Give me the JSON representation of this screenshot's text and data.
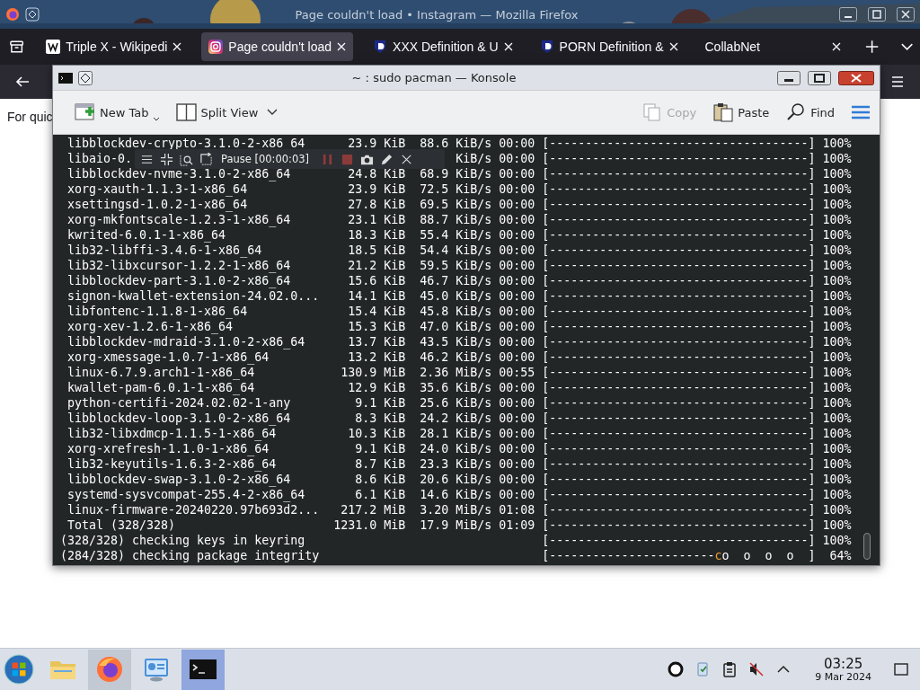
{
  "firefox": {
    "title": "Page couldn't load • Instagram — Mozilla Firefox",
    "tabs": [
      {
        "label": "Triple X - Wikipedi",
        "kind": "page",
        "selected": false
      },
      {
        "label": "Page couldn't load",
        "kind": "camera",
        "selected": true
      },
      {
        "label": "XXX Definition & U",
        "kind": "shield",
        "selected": false
      },
      {
        "label": "PORN Definition &",
        "kind": "shield",
        "selected": false
      },
      {
        "label": "CollabNet",
        "kind": "plain",
        "selected": false
      }
    ],
    "page_text": "For quic"
  },
  "konsole": {
    "title": "~ : sudo pacman — Konsole",
    "toolbar_left": [
      {
        "label": "New Tab",
        "kind": "new-tab",
        "disabled": false
      },
      {
        "label": "Split View",
        "kind": "split",
        "disabled": false
      }
    ],
    "toolbar_right": [
      {
        "label": "Copy",
        "kind": "copy",
        "disabled": true
      },
      {
        "label": "Paste",
        "kind": "paste",
        "disabled": false
      },
      {
        "label": "Find",
        "kind": "find",
        "disabled": false
      }
    ],
    "rows": [
      {
        "kind": "package",
        "name": "libblockdev-crypto-3.1.0-2-x86_64",
        "size": "23.9 KiB",
        "speed": "88.6 KiB/s",
        "time": "00:00",
        "bar": "[------------------------------------]",
        "percent": "100%"
      },
      {
        "kind": "package",
        "name": "libaio-0.",
        "speed": "KiB/s",
        "time": "00:00",
        "bar": "[------------------------------------]",
        "percent": "100%"
      },
      {
        "kind": "package",
        "name": "libblockdev-nvme-3.1.0-2-x86_64",
        "size": "24.8 KiB",
        "speed": "68.9 KiB/s",
        "time": "00:00",
        "bar": "[------------------------------------]",
        "percent": "100%"
      },
      {
        "kind": "package",
        "name": "xorg-xauth-1.1.3-1-x86_64",
        "size": "23.9 KiB",
        "speed": "72.5 KiB/s",
        "time": "00:00",
        "bar": "[------------------------------------]",
        "percent": "100%"
      },
      {
        "kind": "package",
        "name": "xsettingsd-1.0.2-1-x86_64",
        "size": "27.8 KiB",
        "speed": "69.5 KiB/s",
        "time": "00:00",
        "bar": "[------------------------------------]",
        "percent": "100%"
      },
      {
        "kind": "package",
        "name": "xorg-mkfontscale-1.2.3-1-x86_64",
        "size": "23.1 KiB",
        "speed": "88.7 KiB/s",
        "time": "00:00",
        "bar": "[------------------------------------]",
        "percent": "100%"
      },
      {
        "kind": "package",
        "name": "kwrited-6.0.1-1-x86_64",
        "size": "18.3 KiB",
        "speed": "55.4 KiB/s",
        "time": "00:00",
        "bar": "[------------------------------------]",
        "percent": "100%"
      },
      {
        "kind": "package",
        "name": "lib32-libffi-3.4.6-1-x86_64",
        "size": "18.5 KiB",
        "speed": "54.4 KiB/s",
        "time": "00:00",
        "bar": "[------------------------------------]",
        "percent": "100%"
      },
      {
        "kind": "package",
        "name": "lib32-libxcursor-1.2.2-1-x86_64",
        "size": "21.2 KiB",
        "speed": "59.5 KiB/s",
        "time": "00:00",
        "bar": "[------------------------------------]",
        "percent": "100%"
      },
      {
        "kind": "package",
        "name": "libblockdev-part-3.1.0-2-x86_64",
        "size": "15.6 KiB",
        "speed": "46.7 KiB/s",
        "time": "00:00",
        "bar": "[------------------------------------]",
        "percent": "100%"
      },
      {
        "kind": "package",
        "name": "signon-kwallet-extension-24.02.0...",
        "size": "14.1 KiB",
        "speed": "45.0 KiB/s",
        "time": "00:00",
        "bar": "[------------------------------------]",
        "percent": "100%"
      },
      {
        "kind": "package",
        "name": "libfontenc-1.1.8-1-x86_64",
        "size": "15.4 KiB",
        "speed": "45.8 KiB/s",
        "time": "00:00",
        "bar": "[------------------------------------]",
        "percent": "100%"
      },
      {
        "kind": "package",
        "name": "xorg-xev-1.2.6-1-x86_64",
        "size": "15.3 KiB",
        "speed": "47.0 KiB/s",
        "time": "00:00",
        "bar": "[------------------------------------]",
        "percent": "100%"
      },
      {
        "kind": "package",
        "name": "libblockdev-mdraid-3.1.0-2-x86_64",
        "size": "13.7 KiB",
        "speed": "43.5 KiB/s",
        "time": "00:00",
        "bar": "[------------------------------------]",
        "percent": "100%"
      },
      {
        "kind": "package",
        "name": "xorg-xmessage-1.0.7-1-x86_64",
        "size": "13.2 KiB",
        "speed": "46.2 KiB/s",
        "time": "00:00",
        "bar": "[------------------------------------]",
        "percent": "100%"
      },
      {
        "kind": "package",
        "name": "linux-6.7.9.arch1-1-x86_64",
        "size": "130.9 MiB",
        "speed": "2.36 MiB/s",
        "time": "00:55",
        "bar": "[------------------------------------]",
        "percent": "100%"
      },
      {
        "kind": "package",
        "name": "kwallet-pam-6.0.1-1-x86_64",
        "size": "12.9 KiB",
        "speed": "35.6 KiB/s",
        "time": "00:00",
        "bar": "[------------------------------------]",
        "percent": "100%"
      },
      {
        "kind": "package",
        "name": "python-certifi-2024.02.02-1-any",
        "size": "9.1 KiB",
        "speed": "25.6 KiB/s",
        "time": "00:00",
        "bar": "[------------------------------------]",
        "percent": "100%"
      },
      {
        "kind": "package",
        "name": "libblockdev-loop-3.1.0-2-x86_64",
        "size": "8.3 KiB",
        "speed": "24.2 KiB/s",
        "time": "00:00",
        "bar": "[------------------------------------]",
        "percent": "100%"
      },
      {
        "kind": "package",
        "name": "lib32-libxdmcp-1.1.5-1-x86_64",
        "size": "10.3 KiB",
        "speed": "28.1 KiB/s",
        "time": "00:00",
        "bar": "[------------------------------------]",
        "percent": "100%"
      },
      {
        "kind": "package",
        "name": "xorg-xrefresh-1.1.0-1-x86_64",
        "size": "9.1 KiB",
        "speed": "24.0 KiB/s",
        "time": "00:00",
        "bar": "[------------------------------------]",
        "percent": "100%"
      },
      {
        "kind": "package",
        "name": "lib32-keyutils-1.6.3-2-x86_64",
        "size": "8.7 KiB",
        "speed": "23.3 KiB/s",
        "time": "00:00",
        "bar": "[------------------------------------]",
        "percent": "100%"
      },
      {
        "kind": "package",
        "name": "libblockdev-swap-3.1.0-2-x86_64",
        "size": "8.6 KiB",
        "speed": "20.6 KiB/s",
        "time": "00:00",
        "bar": "[------------------------------------]",
        "percent": "100%"
      },
      {
        "kind": "package",
        "name": "systemd-sysvcompat-255.4-2-x86_64",
        "size": "6.1 KiB",
        "speed": "14.6 KiB/s",
        "time": "00:00",
        "bar": "[------------------------------------]",
        "percent": "100%"
      },
      {
        "kind": "package",
        "name": "linux-firmware-20240220.97b693d2...",
        "size": "217.2 MiB",
        "speed": "3.20 MiB/s",
        "time": "01:08",
        "bar": "[------------------------------------]",
        "percent": "100%"
      },
      {
        "kind": "package",
        "name": "Total (328/328)",
        "size": "1231.0 MiB",
        "speed": "17.9 MiB/s",
        "time": "01:09",
        "bar": "[------------------------------------]",
        "percent": "100%"
      },
      {
        "kind": "status",
        "name": "(328/328) checking keys in keyring",
        "bar": "[------------------------------------]",
        "percent": "100%"
      },
      {
        "kind": "status",
        "name": "(284/328) checking package integrity",
        "bar": "[-----------------------",
        "pacman": "c",
        "bar_rest": "o  o  o  o  ]",
        "percent": "64%"
      }
    ],
    "recorder": {
      "status": "Pause [00:00:03]"
    }
  },
  "taskbar": {
    "apps": [
      {
        "kind": "files",
        "running": false,
        "selected": false
      },
      {
        "kind": "browser",
        "running": true,
        "selected": false
      },
      {
        "kind": "monitor",
        "running": false,
        "selected": false
      },
      {
        "kind": "terminal",
        "selected": true
      }
    ],
    "time": "03:25",
    "date": "9 Mar 2024"
  }
}
